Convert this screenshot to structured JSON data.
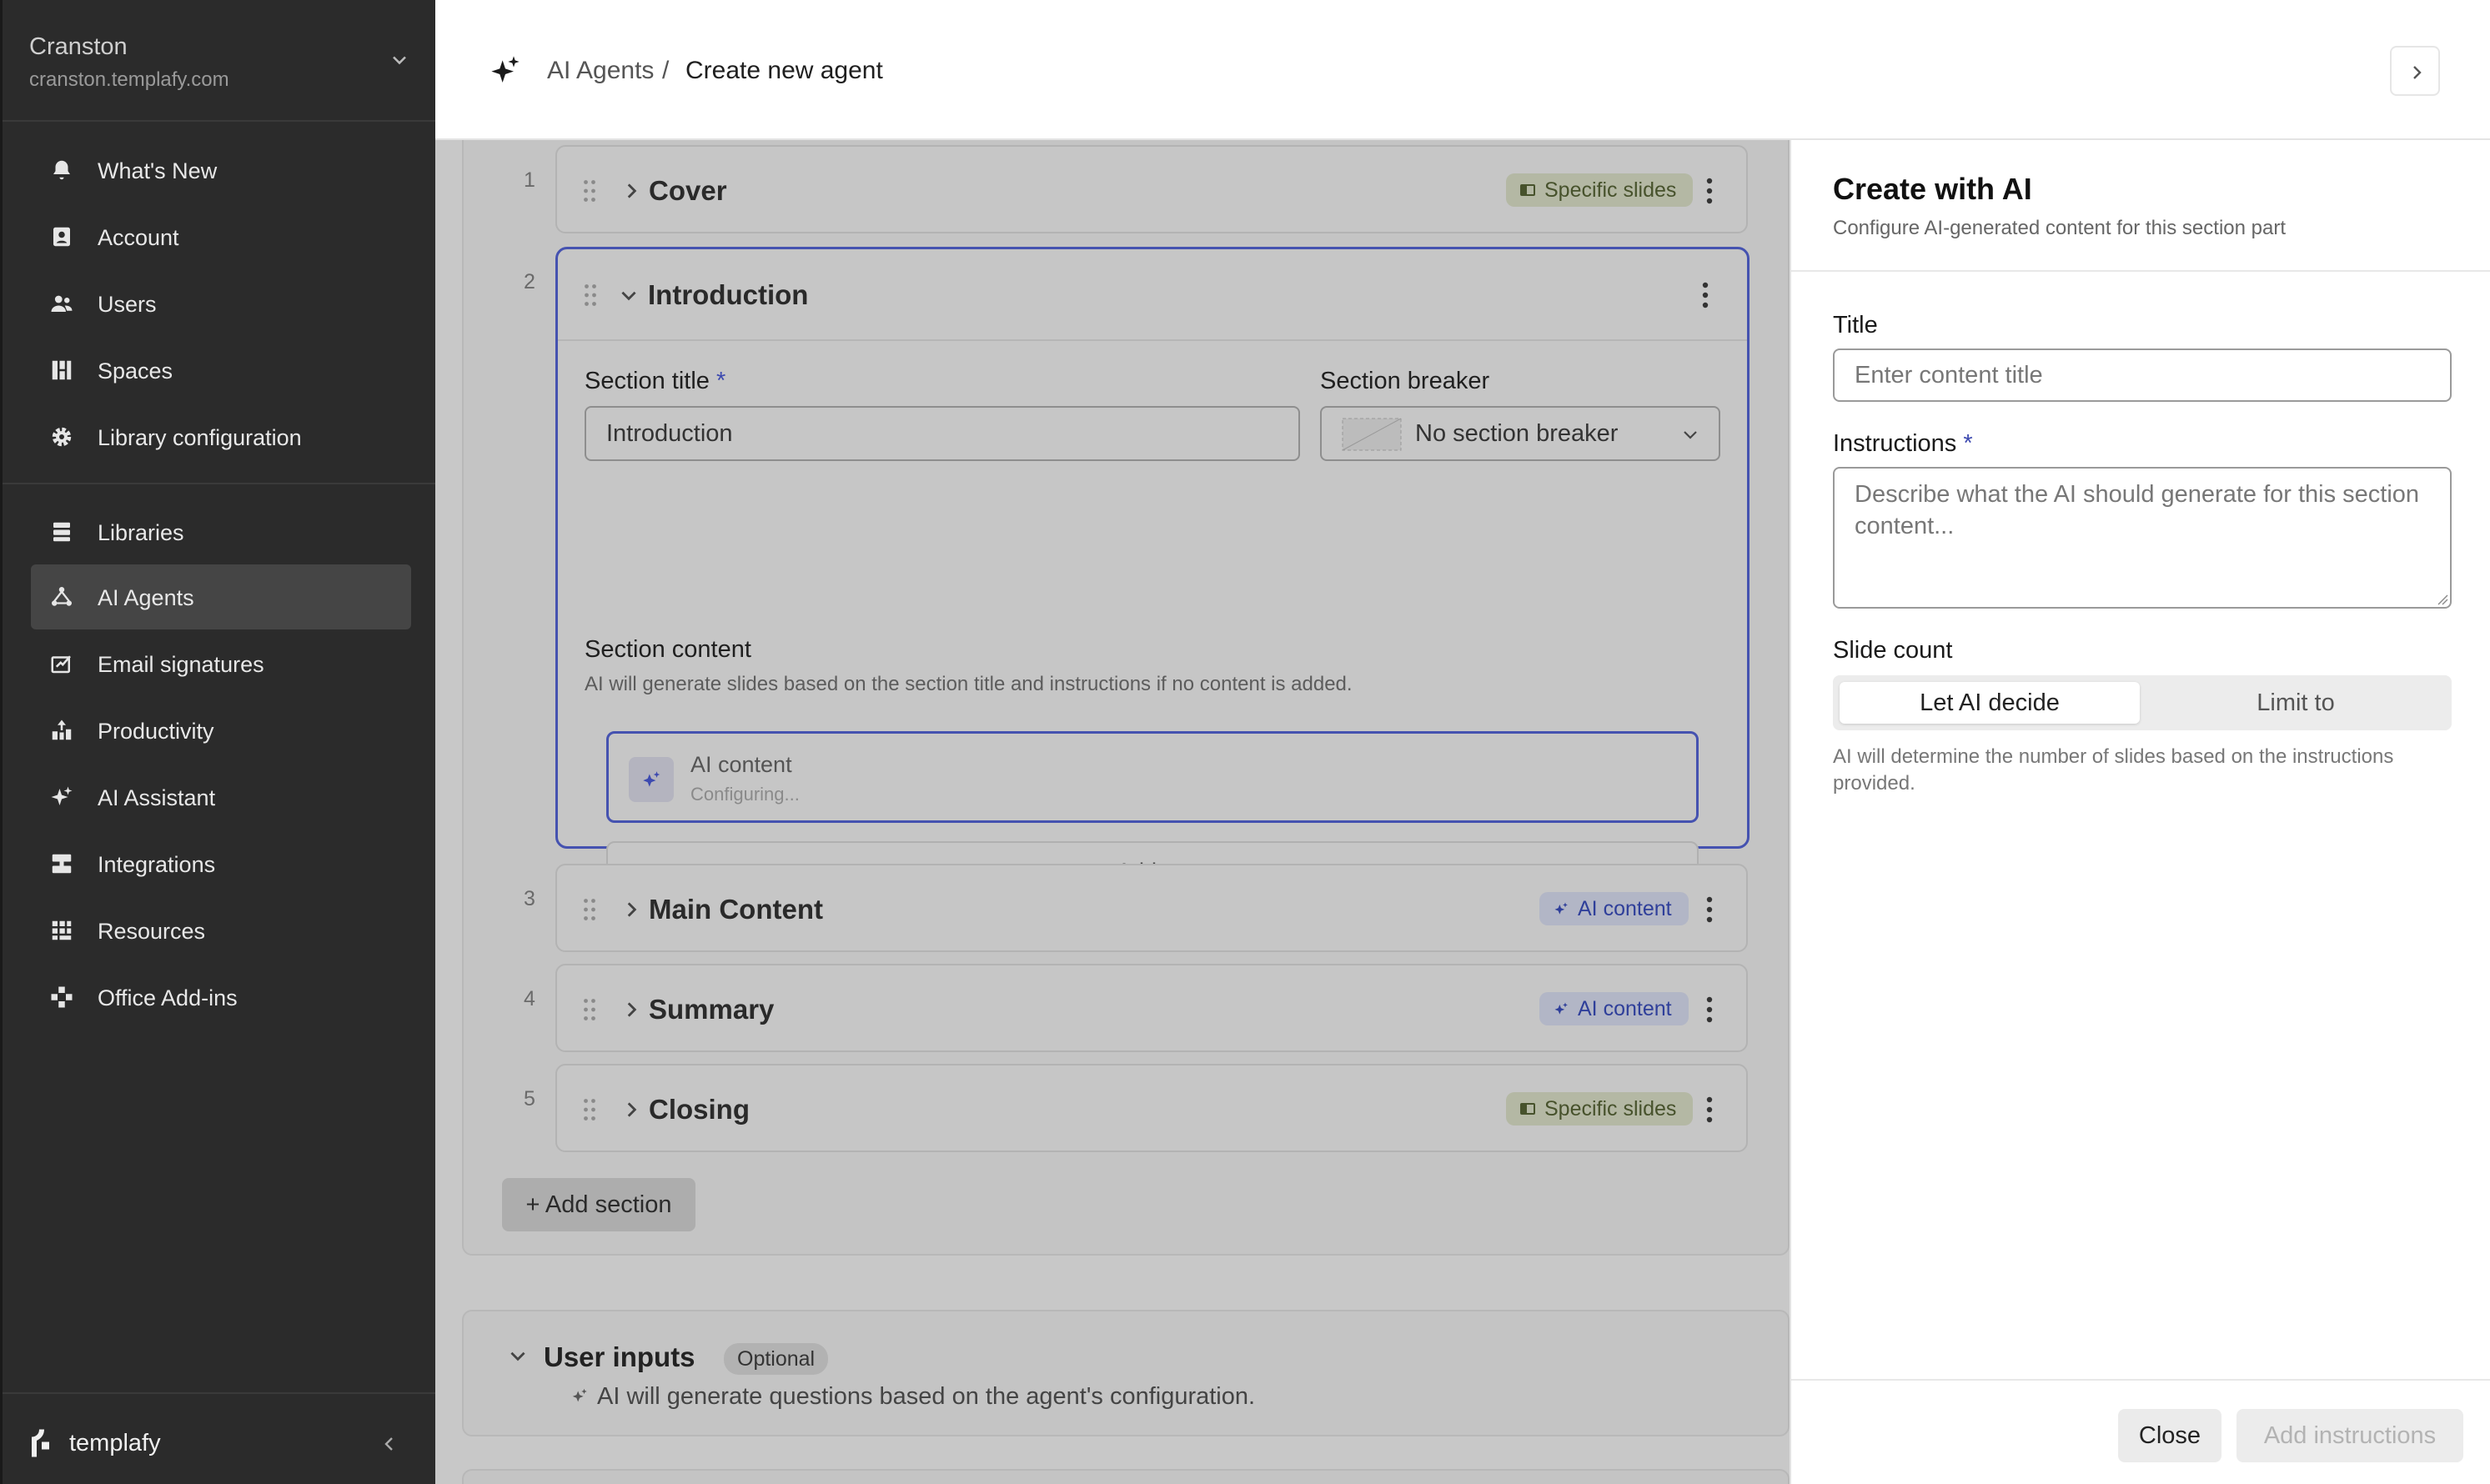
{
  "sidebar": {
    "org_name": "Cranston",
    "org_url": "cranston.templafy.com",
    "items": [
      {
        "label": "What's New",
        "icon": "bell-icon"
      },
      {
        "label": "Account",
        "icon": "account-icon"
      },
      {
        "label": "Users",
        "icon": "users-icon"
      },
      {
        "label": "Spaces",
        "icon": "spaces-icon"
      },
      {
        "label": "Library configuration",
        "icon": "gear-icon"
      },
      {
        "label": "Libraries",
        "icon": "libraries-icon"
      },
      {
        "label": "AI Agents",
        "icon": "agents-icon",
        "active": true
      },
      {
        "label": "Email signatures",
        "icon": "signature-icon"
      },
      {
        "label": "Productivity",
        "icon": "productivity-icon"
      },
      {
        "label": "AI Assistant",
        "icon": "sparkle-icon"
      },
      {
        "label": "Integrations",
        "icon": "integrations-icon"
      },
      {
        "label": "Resources",
        "icon": "resources-icon"
      },
      {
        "label": "Office Add-ins",
        "icon": "addins-icon"
      }
    ],
    "brand": "templafy"
  },
  "header": {
    "crumb_parent": "AI Agents",
    "crumb_sep": "/",
    "crumb_current": "Create new agent"
  },
  "sections": [
    {
      "num": "1",
      "title": "Cover",
      "badge": "Specific slides"
    },
    {
      "num": "2",
      "title": "Introduction"
    },
    {
      "num": "3",
      "title": "Main Content",
      "badge": "AI content"
    },
    {
      "num": "4",
      "title": "Summary",
      "badge": "AI content"
    },
    {
      "num": "5",
      "title": "Closing",
      "badge": "Specific slides"
    }
  ],
  "intro": {
    "section_title_label": "Section title",
    "required_mark": "*",
    "section_title_value": "Introduction",
    "section_breaker_label": "Section breaker",
    "section_breaker_value": "No section breaker",
    "section_content_label": "Section content",
    "section_content_help": "AI will generate slides based on the section title and instructions if no content is added.",
    "ai_content_title": "AI content",
    "ai_content_status": "Configuring...",
    "add_content": "Add content"
  },
  "add_section": "+ Add section",
  "user_inputs": {
    "title": "User inputs",
    "optional": "Optional",
    "desc": "AI will generate questions based on the agent's configuration."
  },
  "panel": {
    "title": "Create with AI",
    "subtitle": "Configure AI-generated content for this section part",
    "title_label": "Title",
    "title_placeholder": "Enter content title",
    "instructions_label": "Instructions",
    "required_mark": "*",
    "instructions_placeholder": "Describe what the AI should generate for this section content...",
    "slide_count_label": "Slide count",
    "opt_auto": "Let AI decide",
    "opt_limit": "Limit to",
    "help": "AI will determine the number of slides based on the instructions provided.",
    "close": "Close",
    "add_instructions": "Add instructions"
  },
  "colors": {
    "accent": "#4552b0",
    "sidebar_bg": "#2b2b2b"
  }
}
